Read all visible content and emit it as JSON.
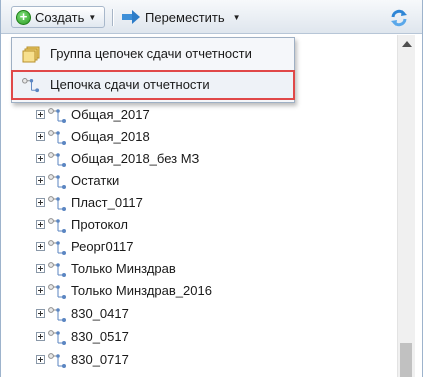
{
  "toolbar": {
    "create_label": "Создать",
    "move_label": "Переместить",
    "icons": {
      "create": "green-plus-icon",
      "move": "blue-arrow-icon",
      "refresh": "refresh-icon"
    }
  },
  "menu": {
    "items": [
      {
        "label": "Группа цепочек сдачи отчетности",
        "icon": "folder-group-icon"
      },
      {
        "label": "Цепочка сдачи отчетности",
        "icon": "chain-icon",
        "highlighted": true
      }
    ]
  },
  "tree": {
    "items": [
      {
        "label": "Общая_2017"
      },
      {
        "label": "Общая_2018"
      },
      {
        "label": "Общая_2018_без МЗ"
      },
      {
        "label": "Остатки"
      },
      {
        "label": "Пласт_0117"
      },
      {
        "label": "Протокол"
      },
      {
        "label": "Реорг0117"
      },
      {
        "label": "Только Минздрав"
      },
      {
        "label": "Только Минздрав_2016"
      },
      {
        "label": "830_0417"
      },
      {
        "label": "830_0517"
      },
      {
        "label": "830_0717"
      }
    ]
  },
  "colors": {
    "highlight_outline": "#e04848",
    "toolbar_border": "#b7c6d7"
  }
}
